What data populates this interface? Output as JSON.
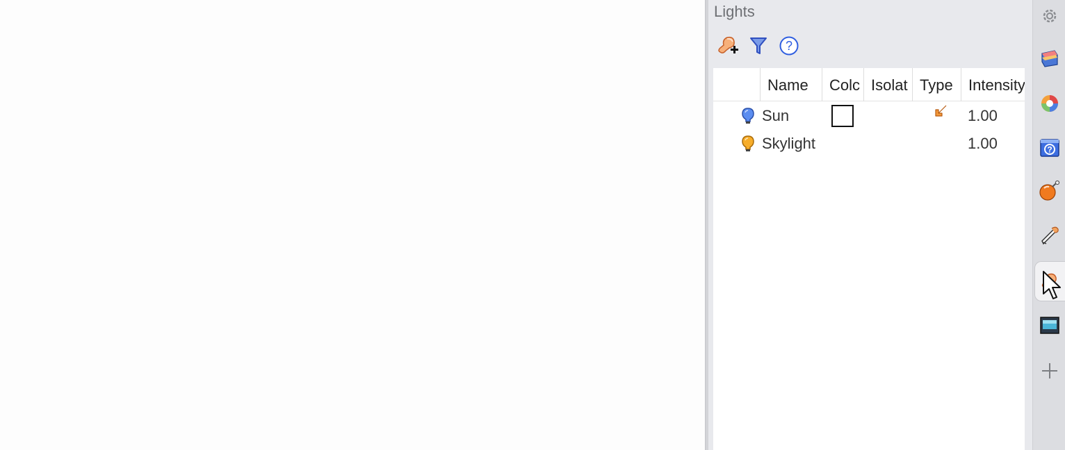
{
  "panel": {
    "title": "Lights"
  },
  "toolbar": {
    "buttons": [
      {
        "icon": "add-light-icon"
      },
      {
        "icon": "filter-icon"
      },
      {
        "icon": "help-icon"
      }
    ]
  },
  "table": {
    "columns": [
      "Name",
      "Colc",
      "Isolat",
      "Type",
      "Intensity"
    ],
    "rows": [
      {
        "name": "Sun",
        "color": "#ffffff",
        "type_icon": "directional-arrow-icon",
        "intensity": "1.00",
        "bulb_color": "#4a7fe0"
      },
      {
        "name": "Skylight",
        "color": "",
        "type_icon": "",
        "intensity": "1.00",
        "bulb_color": "#f5a623"
      }
    ]
  },
  "sidebar": {
    "items": [
      {
        "icon": "gear-icon"
      },
      {
        "icon": "layers-icon"
      },
      {
        "icon": "materials-icon"
      },
      {
        "icon": "help-panel-icon"
      },
      {
        "icon": "environment-icon"
      },
      {
        "icon": "ground-plane-icon"
      },
      {
        "icon": "lights-icon",
        "active": true
      },
      {
        "icon": "display-icon"
      },
      {
        "icon": "plus-icon"
      }
    ]
  },
  "colors": {
    "accent_blue": "#4a6fdc",
    "light_orange": "#f08a3c",
    "panel_bg": "#e8e9ed"
  }
}
